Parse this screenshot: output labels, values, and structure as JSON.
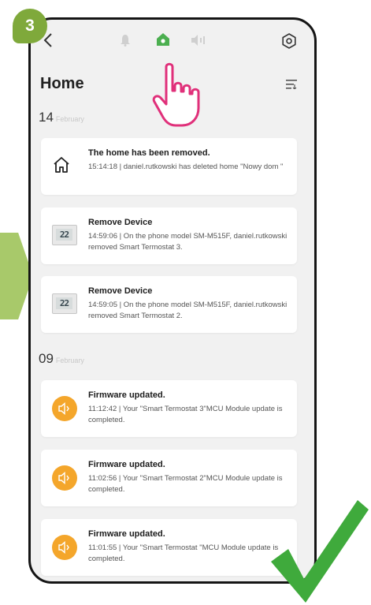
{
  "step_badge": "3",
  "header": {
    "title": "Home",
    "nav_active": "home"
  },
  "groups": [
    {
      "day": "14",
      "month": "February",
      "items": [
        {
          "icon": "home-outline-icon",
          "title": "The home has been removed.",
          "body": "15:14:18 | daniel.rutkowski has deleted home \"Nowy dom \""
        },
        {
          "icon": "thermostat-icon",
          "thumb_text": "22",
          "title": "Remove Device",
          "body": "14:59:06 | On the phone model SM-M515F, daniel.rutkowski removed Smart Termostat 3."
        },
        {
          "icon": "thermostat-icon",
          "thumb_text": "22",
          "title": "Remove Device",
          "body": "14:59:05 | On the phone model SM-M515F, daniel.rutkowski removed Smart Termostat 2."
        }
      ]
    },
    {
      "day": "09",
      "month": "February",
      "items": [
        {
          "icon": "firmware-speaker-icon",
          "title": "Firmware updated.",
          "body": "11:12:42 | Your \"Smart Termostat 3\"MCU Module update is completed."
        },
        {
          "icon": "firmware-speaker-icon",
          "title": "Firmware updated.",
          "body": "11:02:56 | Your \"Smart Termostat 2\"MCU Module update is completed."
        },
        {
          "icon": "firmware-speaker-icon",
          "title": "Firmware updated.",
          "body": "11:01:55 | Your \"Smart Termostat \"MCU Module update is completed."
        }
      ]
    }
  ],
  "colors": {
    "accent_green": "#7fa93b",
    "arrow_green": "#a8c96a",
    "active_tab": "#4caf50",
    "hand_pink": "#e0307a",
    "firmware_orange": "#f4a62b",
    "checkmark": "#3faa3c"
  }
}
